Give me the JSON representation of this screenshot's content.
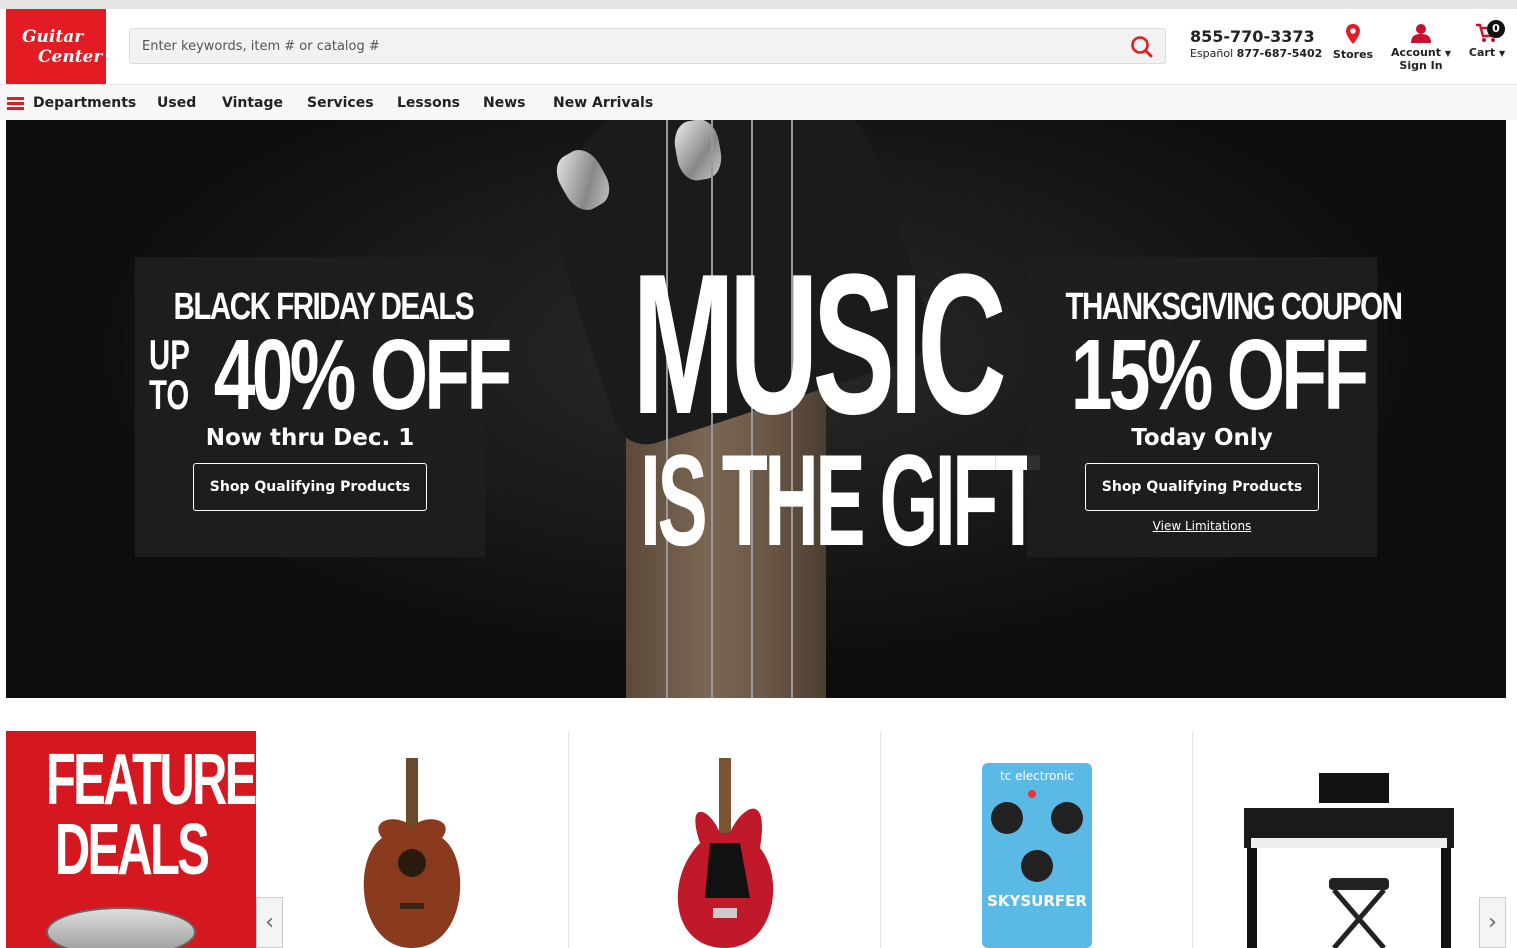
{
  "header": {
    "logo_line1": "Guitar",
    "logo_line2": "Center",
    "search_placeholder": "Enter keywords, item # or catalog #",
    "phone_main": "855-770-3373",
    "phone_espanol_label": "Español",
    "phone_espanol": "877-687-5402",
    "stores_label": "Stores",
    "account_label": "Account",
    "account_sub": "Sign In",
    "cart_label": "Cart",
    "cart_count": "0",
    "brand_color": "#e31b23"
  },
  "nav": {
    "items": [
      "Departments",
      "Used",
      "Vintage",
      "Services",
      "Lessons",
      "News",
      "New Arrivals"
    ]
  },
  "hero": {
    "left_panel": {
      "title": "BLACK FRIDAY DEALS",
      "upto": "UP TO",
      "discount": "40% OFF",
      "subtitle": "Now thru Dec. 1",
      "button": "Shop Qualifying Products"
    },
    "center_line1": "MUSIC",
    "center_line2": "IS THE GIFT",
    "right_panel": {
      "title": "THANKSGIVING COUPON",
      "discount": "15% OFF",
      "subtitle": "Today Only",
      "button": "Shop Qualifying Products",
      "link": "View Limitations"
    }
  },
  "featured": {
    "line1": "FEATURED",
    "line2": "DEALS"
  },
  "products": [
    {
      "icon": "acoustic-guitar"
    },
    {
      "icon": "electric-guitar"
    },
    {
      "icon": "effects-pedal",
      "brand": "tc electronic",
      "name": "SKYSURFER"
    },
    {
      "icon": "digital-piano"
    }
  ]
}
